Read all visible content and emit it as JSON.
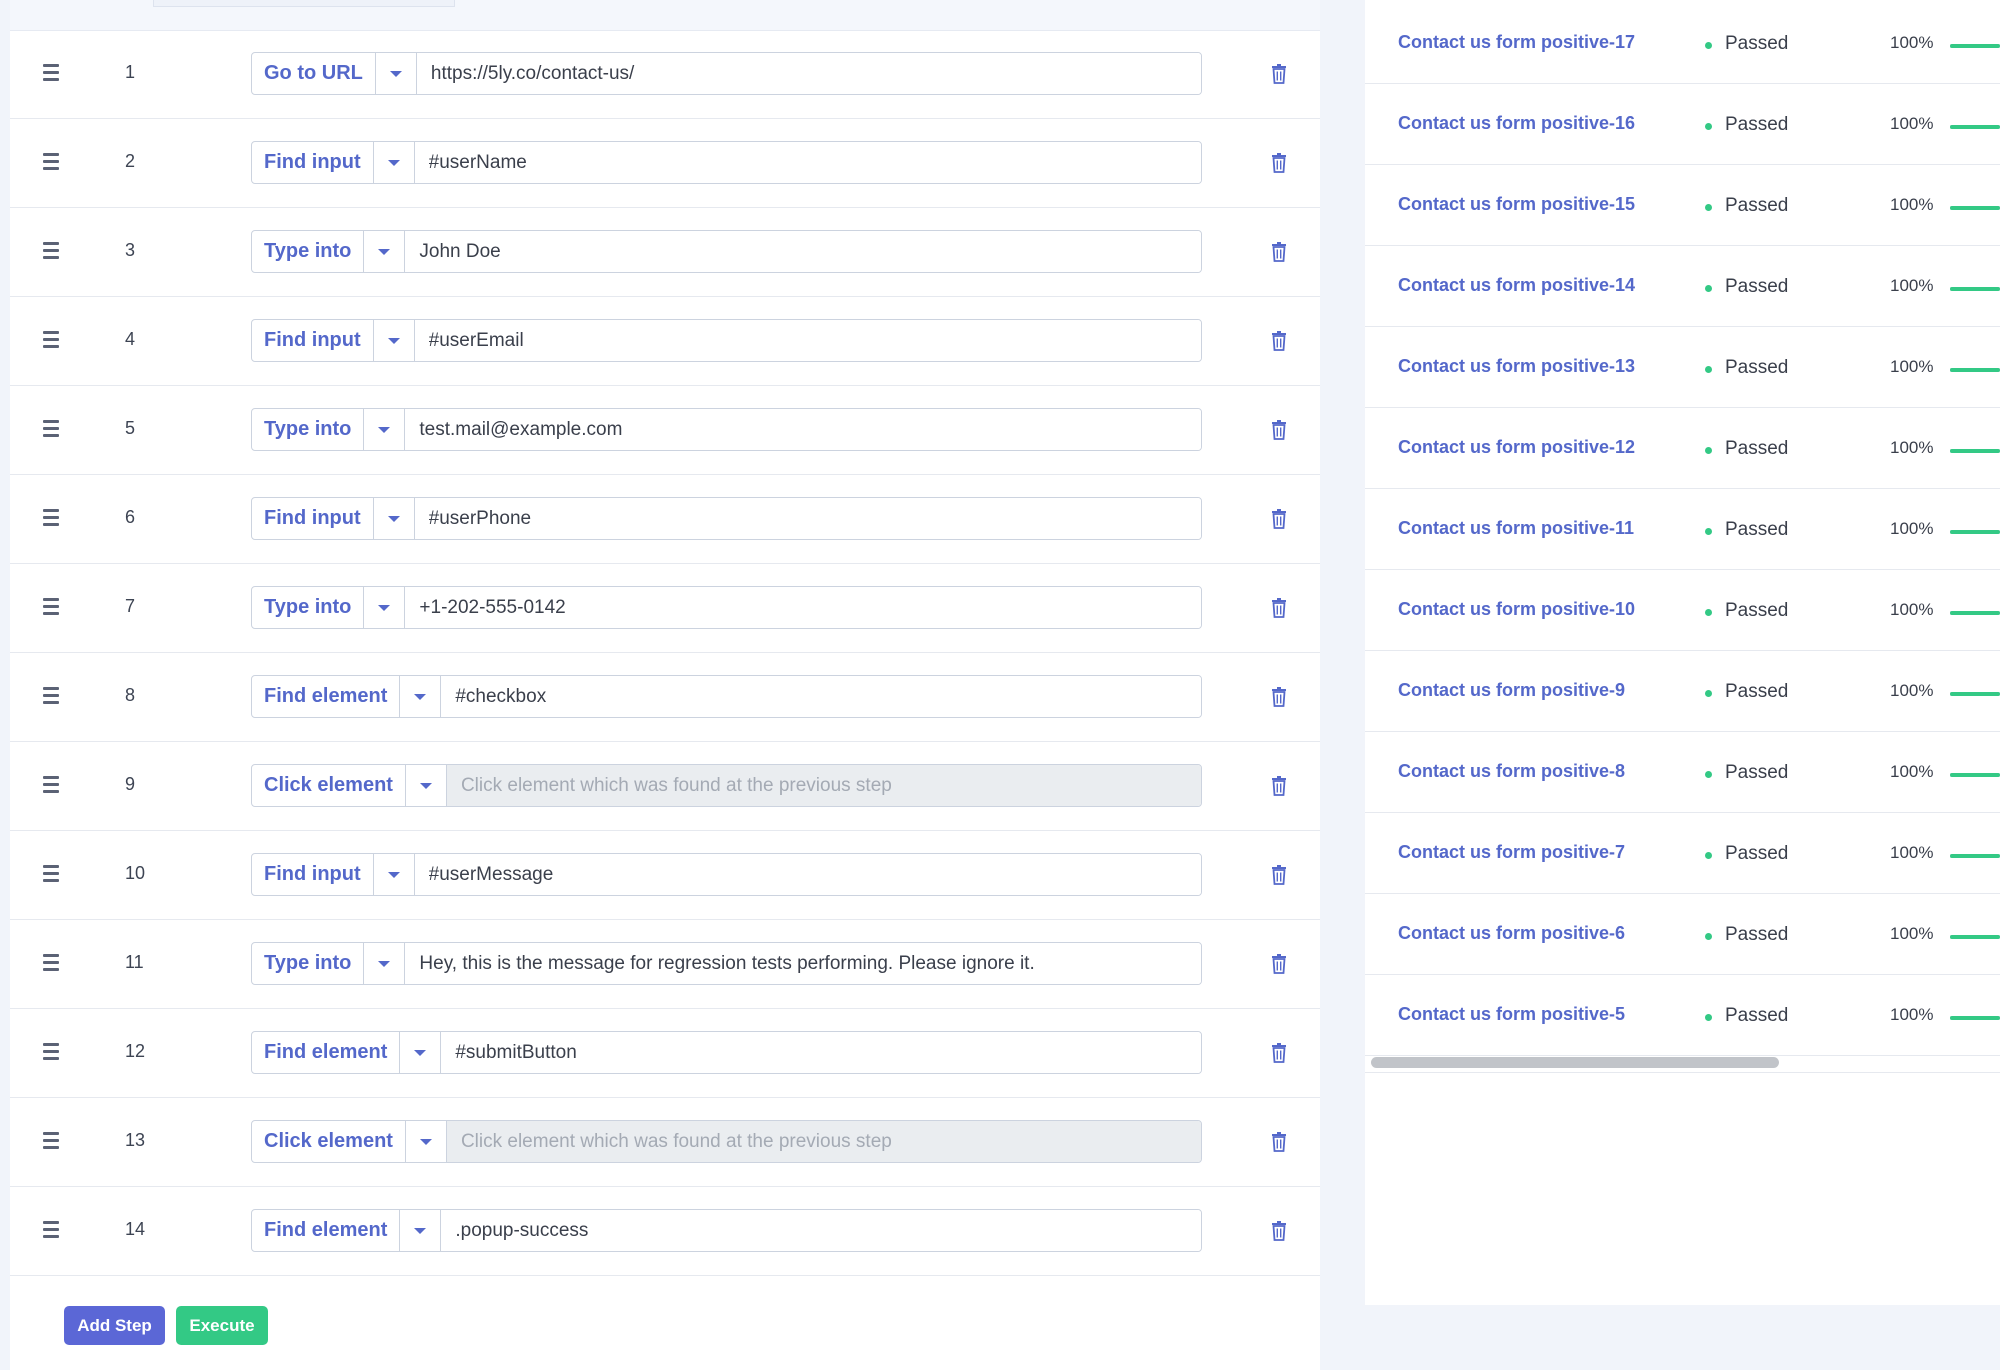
{
  "steps": [
    {
      "number": "1",
      "action": "Go to URL",
      "value": "https://5ly.co/contact-us/",
      "placeholder": ""
    },
    {
      "number": "2",
      "action": "Find input",
      "value": "#userName",
      "placeholder": ""
    },
    {
      "number": "3",
      "action": "Type into",
      "value": "John Doe",
      "placeholder": ""
    },
    {
      "number": "4",
      "action": "Find input",
      "value": "#userEmail",
      "placeholder": ""
    },
    {
      "number": "5",
      "action": "Type into",
      "value": "test.mail@example.com",
      "placeholder": ""
    },
    {
      "number": "6",
      "action": "Find input",
      "value": "#userPhone",
      "placeholder": ""
    },
    {
      "number": "7",
      "action": "Type into",
      "value": "+1-202-555-0142",
      "placeholder": ""
    },
    {
      "number": "8",
      "action": "Find element",
      "value": "#checkbox",
      "placeholder": ""
    },
    {
      "number": "9",
      "action": "Click element",
      "value": "",
      "placeholder": "Click element which was found at the previous step",
      "disabled": true
    },
    {
      "number": "10",
      "action": "Find input",
      "value": "#userMessage",
      "placeholder": ""
    },
    {
      "number": "11",
      "action": "Type into",
      "value": "Hey, this is the message for regression tests performing. Please ignore it.",
      "placeholder": ""
    },
    {
      "number": "12",
      "action": "Find element",
      "value": "#submitButton",
      "placeholder": ""
    },
    {
      "number": "13",
      "action": "Click element",
      "value": "",
      "placeholder": "Click element which was found at the previous step",
      "disabled": true
    },
    {
      "number": "14",
      "action": "Find element",
      "value": ".popup-success",
      "placeholder": ""
    }
  ],
  "buttons": {
    "add_step": "Add Step",
    "execute": "Execute"
  },
  "results": [
    {
      "name": "Contact us form positive-17",
      "status": "Passed",
      "percent": "100%",
      "progress": 1.0
    },
    {
      "name": "Contact us form positive-16",
      "status": "Passed",
      "percent": "100%",
      "progress": 1.0
    },
    {
      "name": "Contact us form positive-15",
      "status": "Passed",
      "percent": "100%",
      "progress": 1.0
    },
    {
      "name": "Contact us form positive-14",
      "status": "Passed",
      "percent": "100%",
      "progress": 1.0
    },
    {
      "name": "Contact us form positive-13",
      "status": "Passed",
      "percent": "100%",
      "progress": 1.0
    },
    {
      "name": "Contact us form positive-12",
      "status": "Passed",
      "percent": "100%",
      "progress": 1.0
    },
    {
      "name": "Contact us form positive-11",
      "status": "Passed",
      "percent": "100%",
      "progress": 1.0
    },
    {
      "name": "Contact us form positive-10",
      "status": "Passed",
      "percent": "100%",
      "progress": 1.0
    },
    {
      "name": "Contact us form positive-9",
      "status": "Passed",
      "percent": "100%",
      "progress": 1.0
    },
    {
      "name": "Contact us form positive-8",
      "status": "Passed",
      "percent": "100%",
      "progress": 1.0
    },
    {
      "name": "Contact us form positive-7",
      "status": "Passed",
      "percent": "100%",
      "progress": 1.0
    },
    {
      "name": "Contact us form positive-6",
      "status": "Passed",
      "percent": "100%",
      "progress": 1.0
    },
    {
      "name": "Contact us form positive-5",
      "status": "Passed",
      "percent": "100%",
      "progress": 1.0
    }
  ],
  "colors": {
    "accent": "#5468ca",
    "passed": "#33c985",
    "add_button": "#5b67d6",
    "execute_button": "#33c985"
  },
  "icons": {
    "drag": "drag-handle-icon",
    "caret": "caret-down-icon",
    "delete": "trash-icon",
    "status": "status-dot-icon"
  }
}
